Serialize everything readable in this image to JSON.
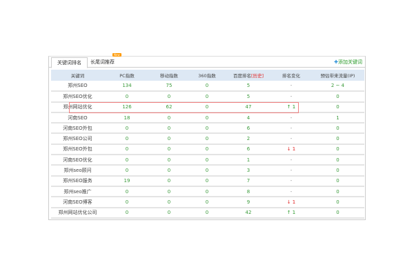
{
  "tabs": [
    {
      "label": "关键词排名",
      "active": true
    },
    {
      "label": "长尾词推荐",
      "badge": "New"
    }
  ],
  "add_button": {
    "icon": "plus-icon",
    "label": "添加关键词"
  },
  "columns": [
    "关键词",
    "PC指数",
    "移动指数",
    "360指数",
    "百度排名",
    "排名变化",
    "预估带来流量(IP)"
  ],
  "history_link": "[历史]",
  "colors": {
    "accent_green": "#3a9a3a",
    "up": "#2a9a2a",
    "down": "#e02020",
    "header_bg": "#dde8f4",
    "highlight": "#f08080"
  },
  "rows": [
    [
      "郑州SEO",
      "134",
      "75",
      "0",
      "5",
      "-",
      "2 ~ 4"
    ],
    [
      "郑州SEO优化",
      "0",
      "0",
      "0",
      "5",
      "-",
      "0"
    ],
    [
      "郑州网站优化",
      "126",
      "62",
      "0",
      "47",
      "↑ 1",
      "0"
    ],
    [
      "河南SEO",
      "18",
      "0",
      "0",
      "4",
      "-",
      "1"
    ],
    [
      "河南SEO外包",
      "0",
      "0",
      "0",
      "6",
      "-",
      "0"
    ],
    [
      "郑州SEO公司",
      "0",
      "0",
      "0",
      "2",
      "-",
      "0"
    ],
    [
      "郑州SEO外包",
      "0",
      "0",
      "0",
      "6",
      "↓ 1",
      "0"
    ],
    [
      "河南SEO优化",
      "0",
      "0",
      "0",
      "1",
      "-",
      "0"
    ],
    [
      "郑州seo顾问",
      "0",
      "0",
      "0",
      "3",
      "-",
      "0"
    ],
    [
      "郑州SEO服务",
      "19",
      "0",
      "0",
      "7",
      "-",
      "0"
    ],
    [
      "郑州seo推广",
      "0",
      "0",
      "0",
      "8",
      "-",
      "0"
    ],
    [
      "河南SEO博客",
      "0",
      "0",
      "0",
      "9",
      "↓ 1",
      "0"
    ],
    [
      "郑州网站优化公司",
      "0",
      "0",
      "0",
      "42",
      "↑ 1",
      "0"
    ]
  ]
}
